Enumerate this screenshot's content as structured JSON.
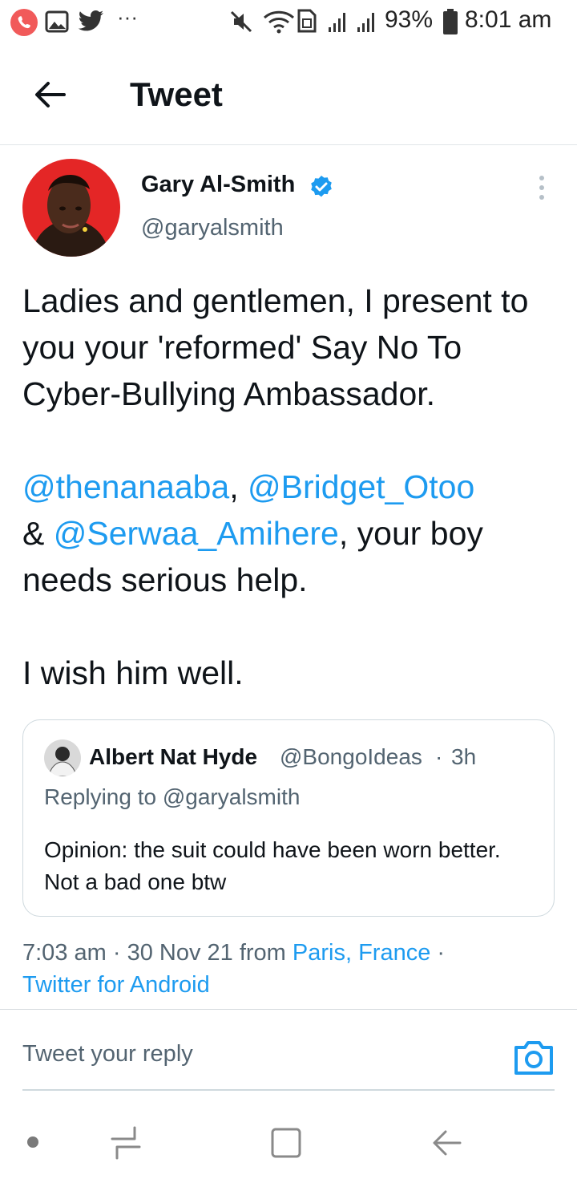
{
  "status_bar": {
    "battery": "93%",
    "time": "8:01 am",
    "overflow": "···",
    "icons": [
      "whatsapp-icon",
      "gallery-icon",
      "twitter-icon",
      "mute-icon",
      "wifi-icon",
      "sim-icon",
      "signal-icon",
      "battery-icon"
    ]
  },
  "header": {
    "title": "Tweet",
    "back_icon": "arrow-left-icon"
  },
  "tweet": {
    "author_name": "Gary Al-Smith",
    "author_handle": "@garyalsmith",
    "line1": "Ladies and gentlemen, I present to you your 'reformed' Say No To Cyber-Bullying Ambassador.",
    "mention1": "@thenanaaba",
    "comma": ", ",
    "mention2": "@Bridget_Otoo",
    "amp": "& ",
    "mention3": "@Serwaa_Amihere",
    "line2_end": ", your boy needs serious help.",
    "line3": "I wish him well."
  },
  "quoted": {
    "name": "Albert Nat Hyde",
    "handle": "@BongoIdeas",
    "sep": "·",
    "time": "3h",
    "replying": "Replying to @garyalsmith",
    "text": "Opinion: the suit could have been worn better. Not a bad one btw"
  },
  "meta": {
    "time": "7:03 am",
    "dot1": " · ",
    "date": "30 Nov 21",
    "from": " from ",
    "location": "Paris, France",
    "dot2": " ·",
    "source": "Twitter for Android"
  },
  "reply": {
    "placeholder": "Tweet your reply"
  },
  "colors": {
    "accent": "#1d9bf0",
    "text": "#0f1419",
    "muted": "#536471"
  }
}
